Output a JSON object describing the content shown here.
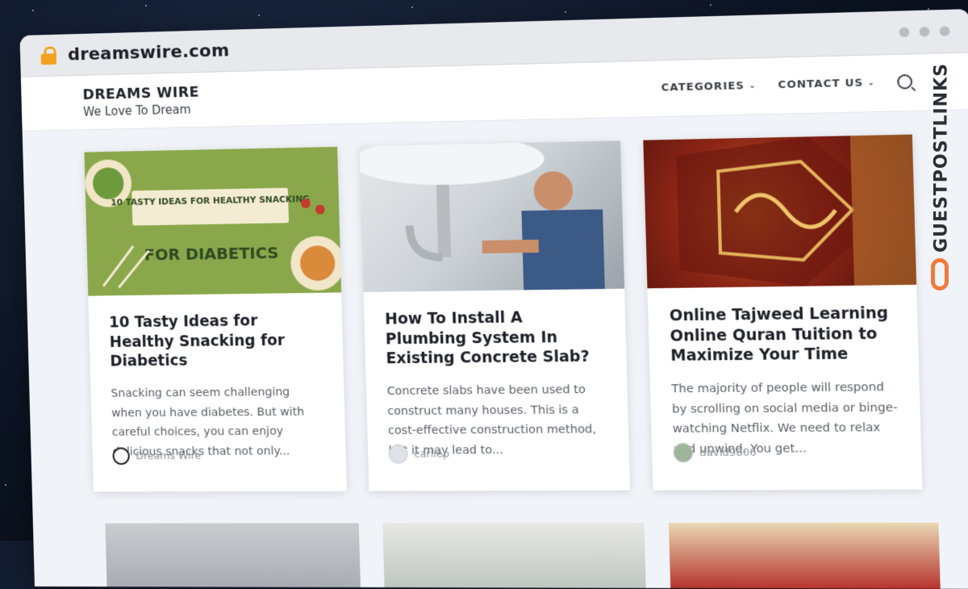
{
  "browser": {
    "url": "dreamswire.com"
  },
  "site": {
    "title": "DREAMS WIRE",
    "tagline": "We Love To Dream"
  },
  "nav": {
    "categories": "CATEGORIES",
    "contact": "CONTACT US"
  },
  "posts": [
    {
      "title": "10 Tasty Ideas for Healthy Snacking for Diabetics",
      "excerpt": "Snacking can seem challenging when you have diabetes. But with careful choices, you can enjoy delicious snacks that not only...",
      "author": "Dreams Wire",
      "image_text_1": "10 TASTY IDEAS FOR HEALTHY SNACKING",
      "image_text_2": "FOR DIABETICS"
    },
    {
      "title": "How To Install A Plumbing System In Existing Concrete Slab?",
      "excerpt": "Concrete slabs have been used to construct many houses. This is a cost-effective construction method, but it may lead to...",
      "author": "carliep"
    },
    {
      "title": "Online Tajweed Learning Online Quran Tuition to Maximize Your Time",
      "excerpt": "The majority of people will respond by scrolling on social media or binge-watching Netflix. We need to relax and unwind. You get...",
      "author": "david9806"
    }
  ],
  "watermark": "GUESTPOSTLINKS",
  "colors": {
    "lock": "#f4a11d",
    "accent": "#f07a3c",
    "thumb1": "#8aa84b"
  }
}
